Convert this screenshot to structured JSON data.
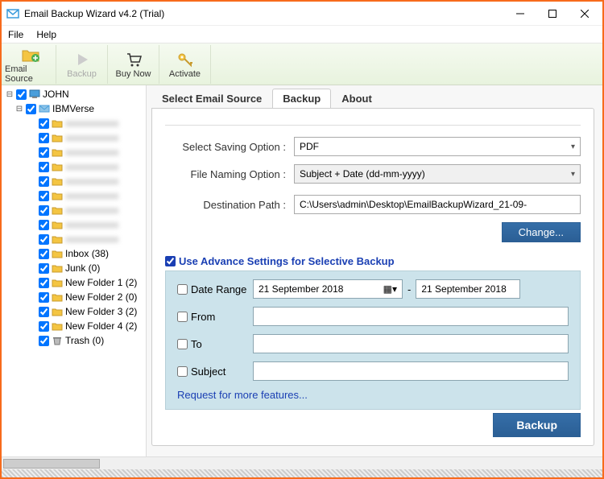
{
  "window": {
    "title": "Email Backup Wizard v4.2 (Trial)"
  },
  "menu": {
    "file": "File",
    "help": "Help"
  },
  "toolbar": {
    "email_source": "Email Source",
    "backup": "Backup",
    "buy_now": "Buy Now",
    "activate": "Activate"
  },
  "tree": {
    "root": "JOHN",
    "source": "IBMVerse",
    "folders": [
      {
        "label": "Inbox (38)"
      },
      {
        "label": "Junk (0)"
      },
      {
        "label": "New Folder 1 (2)"
      },
      {
        "label": "New Folder 2 (0)"
      },
      {
        "label": "New Folder 3 (2)"
      },
      {
        "label": "New Folder 4 (2)"
      },
      {
        "label": "Trash (0)"
      }
    ]
  },
  "tabs": {
    "t1": "Select Email Source",
    "t2": "Backup",
    "t3": "About"
  },
  "form": {
    "saving_label": "Select Saving Option :",
    "saving_value": "PDF",
    "naming_label": "File Naming Option :",
    "naming_value": "Subject + Date (dd-mm-yyyy)",
    "dest_label": "Destination Path :",
    "dest_value": "C:\\Users\\admin\\Desktop\\EmailBackupWizard_21-09-",
    "change": "Change..."
  },
  "advanced": {
    "header": "Use Advance Settings for Selective Backup",
    "date_range": "Date Range",
    "date_from": "21 September 2018",
    "date_to": "21 September 2018",
    "from": "From",
    "to": "To",
    "subject": "Subject",
    "request": "Request for more features..."
  },
  "buttons": {
    "backup": "Backup"
  }
}
